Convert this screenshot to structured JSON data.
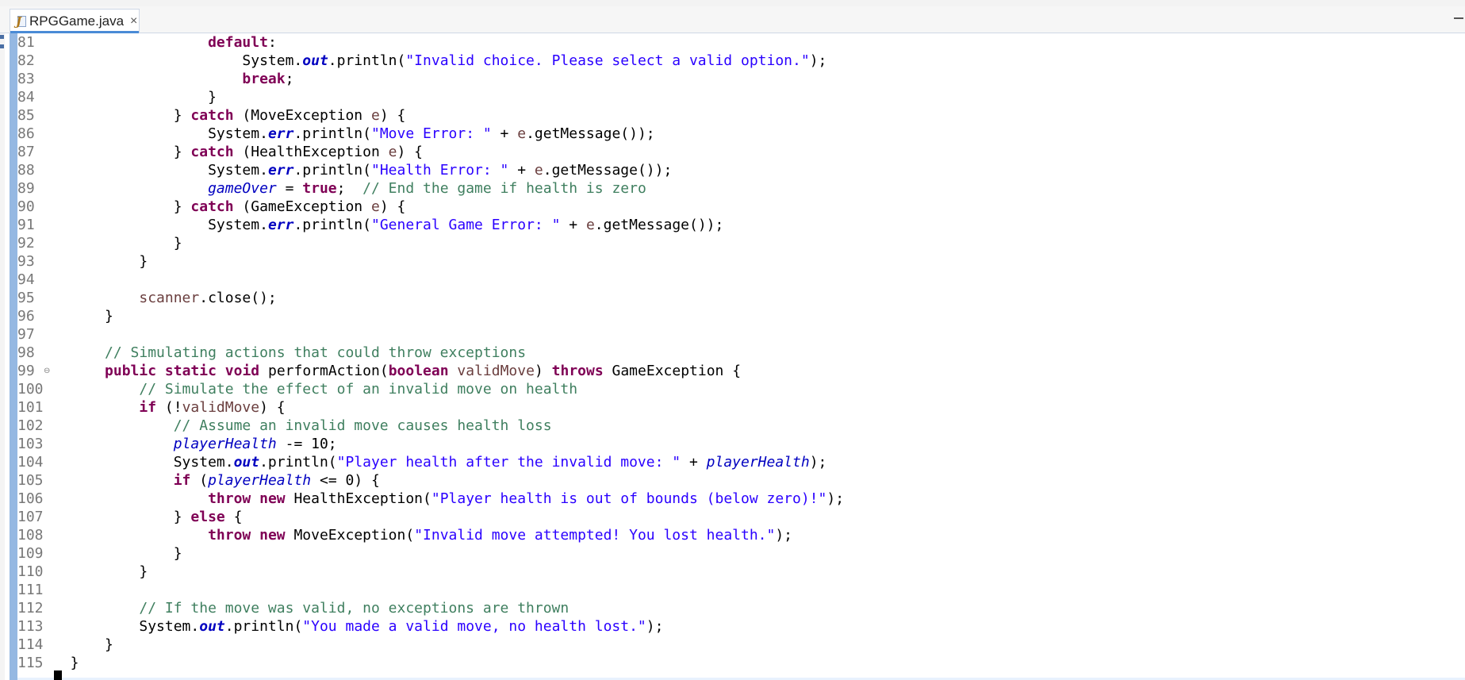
{
  "tab": {
    "title": "RPGGame.java",
    "close": "×",
    "icon": "java-file-icon"
  },
  "editor": {
    "lines": [
      {
        "n": "81",
        "segs": [
          [
            "p",
            "                  "
          ],
          [
            "kw",
            "default"
          ],
          [
            "p",
            ":"
          ]
        ]
      },
      {
        "n": "82",
        "segs": [
          [
            "p",
            "                      System."
          ],
          [
            "sf",
            "out"
          ],
          [
            "p",
            ".println("
          ],
          [
            "str",
            "\"Invalid choice. Please select a valid option.\""
          ],
          [
            "p",
            ");"
          ]
        ]
      },
      {
        "n": "83",
        "segs": [
          [
            "p",
            "                      "
          ],
          [
            "kw",
            "break"
          ],
          [
            "p",
            ";"
          ]
        ]
      },
      {
        "n": "84",
        "segs": [
          [
            "p",
            "                  }"
          ]
        ]
      },
      {
        "n": "85",
        "segs": [
          [
            "p",
            "              } "
          ],
          [
            "kw",
            "catch"
          ],
          [
            "p",
            " (MoveException "
          ],
          [
            "loc",
            "e"
          ],
          [
            "p",
            ") {"
          ]
        ]
      },
      {
        "n": "86",
        "segs": [
          [
            "p",
            "                  System."
          ],
          [
            "sf",
            "err"
          ],
          [
            "p",
            ".println("
          ],
          [
            "str",
            "\"Move Error: \""
          ],
          [
            "p",
            " + "
          ],
          [
            "loc",
            "e"
          ],
          [
            "p",
            ".getMessage());"
          ]
        ]
      },
      {
        "n": "87",
        "segs": [
          [
            "p",
            "              } "
          ],
          [
            "kw",
            "catch"
          ],
          [
            "p",
            " (HealthException "
          ],
          [
            "loc",
            "e"
          ],
          [
            "p",
            ") {"
          ]
        ]
      },
      {
        "n": "88",
        "segs": [
          [
            "p",
            "                  System."
          ],
          [
            "sf",
            "err"
          ],
          [
            "p",
            ".println("
          ],
          [
            "str",
            "\"Health Error: \""
          ],
          [
            "p",
            " + "
          ],
          [
            "loc",
            "e"
          ],
          [
            "p",
            ".getMessage());"
          ]
        ]
      },
      {
        "n": "89",
        "segs": [
          [
            "p",
            "                  "
          ],
          [
            "pf",
            "gameOver"
          ],
          [
            "p",
            " = "
          ],
          [
            "kw",
            "true"
          ],
          [
            "p",
            ";  "
          ],
          [
            "cm",
            "// End the game if health is zero"
          ]
        ]
      },
      {
        "n": "90",
        "segs": [
          [
            "p",
            "              } "
          ],
          [
            "kw",
            "catch"
          ],
          [
            "p",
            " (GameException "
          ],
          [
            "loc",
            "e"
          ],
          [
            "p",
            ") {"
          ]
        ]
      },
      {
        "n": "91",
        "segs": [
          [
            "p",
            "                  System."
          ],
          [
            "sf",
            "err"
          ],
          [
            "p",
            ".println("
          ],
          [
            "str",
            "\"General Game Error: \""
          ],
          [
            "p",
            " + "
          ],
          [
            "loc",
            "e"
          ],
          [
            "p",
            ".getMessage());"
          ]
        ]
      },
      {
        "n": "92",
        "segs": [
          [
            "p",
            "              }"
          ]
        ]
      },
      {
        "n": "93",
        "segs": [
          [
            "p",
            "          }"
          ]
        ]
      },
      {
        "n": "94",
        "segs": [
          [
            "p",
            ""
          ]
        ]
      },
      {
        "n": "95",
        "segs": [
          [
            "p",
            "          "
          ],
          [
            "loc",
            "scanner"
          ],
          [
            "p",
            ".close();"
          ]
        ]
      },
      {
        "n": "96",
        "segs": [
          [
            "p",
            "      }"
          ]
        ]
      },
      {
        "n": "97",
        "segs": [
          [
            "p",
            ""
          ]
        ]
      },
      {
        "n": "98",
        "segs": [
          [
            "p",
            "      "
          ],
          [
            "cm",
            "// Simulating actions that could throw exceptions"
          ]
        ]
      },
      {
        "n": "99",
        "fold": "⊖",
        "segs": [
          [
            "p",
            "      "
          ],
          [
            "kw",
            "public"
          ],
          [
            "p",
            " "
          ],
          [
            "kw",
            "static"
          ],
          [
            "p",
            " "
          ],
          [
            "kw",
            "void"
          ],
          [
            "p",
            " performAction("
          ],
          [
            "kw",
            "boolean"
          ],
          [
            "p",
            " "
          ],
          [
            "loc",
            "validMove"
          ],
          [
            "p",
            ") "
          ],
          [
            "kw",
            "throws"
          ],
          [
            "p",
            " GameException {"
          ]
        ]
      },
      {
        "n": "100",
        "segs": [
          [
            "p",
            "          "
          ],
          [
            "cm",
            "// Simulate the effect of an invalid move on health"
          ]
        ]
      },
      {
        "n": "101",
        "segs": [
          [
            "p",
            "          "
          ],
          [
            "kw",
            "if"
          ],
          [
            "p",
            " (!"
          ],
          [
            "loc",
            "validMove"
          ],
          [
            "p",
            ") {"
          ]
        ]
      },
      {
        "n": "102",
        "segs": [
          [
            "p",
            "              "
          ],
          [
            "cm",
            "// Assume an invalid move causes health loss"
          ]
        ]
      },
      {
        "n": "103",
        "segs": [
          [
            "p",
            "              "
          ],
          [
            "pf",
            "playerHealth"
          ],
          [
            "p",
            " -= 10;"
          ]
        ]
      },
      {
        "n": "104",
        "segs": [
          [
            "p",
            "              System."
          ],
          [
            "sf",
            "out"
          ],
          [
            "p",
            ".println("
          ],
          [
            "str",
            "\"Player health after the invalid move: \""
          ],
          [
            "p",
            " + "
          ],
          [
            "pf",
            "playerHealth"
          ],
          [
            "p",
            ");"
          ]
        ]
      },
      {
        "n": "105",
        "segs": [
          [
            "p",
            "              "
          ],
          [
            "kw",
            "if"
          ],
          [
            "p",
            " ("
          ],
          [
            "pf",
            "playerHealth"
          ],
          [
            "p",
            " <= 0) {"
          ]
        ]
      },
      {
        "n": "106",
        "segs": [
          [
            "p",
            "                  "
          ],
          [
            "kw",
            "throw"
          ],
          [
            "p",
            " "
          ],
          [
            "kw",
            "new"
          ],
          [
            "p",
            " HealthException("
          ],
          [
            "str",
            "\"Player health is out of bounds (below zero)!\""
          ],
          [
            "p",
            ");"
          ]
        ]
      },
      {
        "n": "107",
        "segs": [
          [
            "p",
            "              } "
          ],
          [
            "kw",
            "else"
          ],
          [
            "p",
            " {"
          ]
        ]
      },
      {
        "n": "108",
        "segs": [
          [
            "p",
            "                  "
          ],
          [
            "kw",
            "throw"
          ],
          [
            "p",
            " "
          ],
          [
            "kw",
            "new"
          ],
          [
            "p",
            " MoveException("
          ],
          [
            "str",
            "\"Invalid move attempted! You lost health.\""
          ],
          [
            "p",
            ");"
          ]
        ]
      },
      {
        "n": "109",
        "segs": [
          [
            "p",
            "              }"
          ]
        ]
      },
      {
        "n": "110",
        "segs": [
          [
            "p",
            "          }"
          ]
        ]
      },
      {
        "n": "111",
        "segs": [
          [
            "p",
            ""
          ]
        ]
      },
      {
        "n": "112",
        "segs": [
          [
            "p",
            "          "
          ],
          [
            "cm",
            "// If the move was valid, no exceptions are thrown"
          ]
        ]
      },
      {
        "n": "113",
        "segs": [
          [
            "p",
            "          System."
          ],
          [
            "sf",
            "out"
          ],
          [
            "p",
            ".println("
          ],
          [
            "str",
            "\"You made a valid move, no health lost.\""
          ],
          [
            "p",
            ");"
          ]
        ]
      },
      {
        "n": "114",
        "segs": [
          [
            "p",
            "      }"
          ]
        ]
      },
      {
        "n": "115",
        "segs": [
          [
            "p",
            "  }"
          ]
        ]
      }
    ]
  }
}
